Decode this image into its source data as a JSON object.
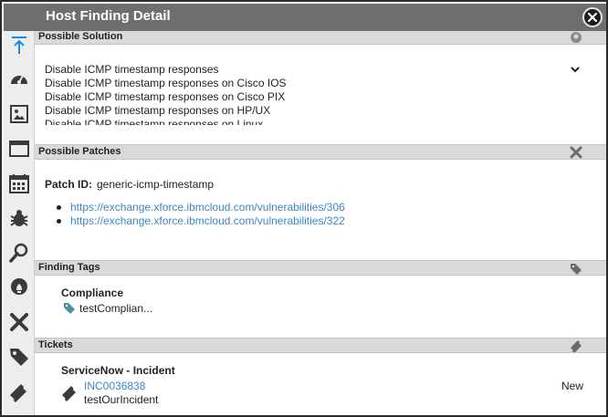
{
  "window": {
    "title": "Host Finding Detail"
  },
  "sidebar": {
    "icons": [
      "arrow-up-icon",
      "gauge-icon",
      "image-icon",
      "window-icon",
      "calendar-icon",
      "bug-icon",
      "wrench-icon",
      "lightbulb-icon",
      "tools-icon",
      "tag-icon",
      "ticket-icon"
    ]
  },
  "solution": {
    "header": "Possible Solution",
    "lines": [
      "Disable ICMP timestamp responses",
      "Disable ICMP timestamp responses on Cisco IOS",
      "Disable ICMP timestamp responses on Cisco PIX",
      "Disable ICMP timestamp responses on HP/UX",
      "Disable ICMP timestamp responses on Linux"
    ]
  },
  "patches": {
    "header": "Possible Patches",
    "patch_id_label": "Patch ID:",
    "patch_id": "generic-icmp-timestamp",
    "links": [
      "https://exchange.xforce.ibmcloud.com/vulnerabilities/306",
      "https://exchange.xforce.ibmcloud.com/vulnerabilities/322"
    ]
  },
  "tags": {
    "header": "Finding Tags",
    "category": "Compliance",
    "tag": "testComplian..."
  },
  "tickets": {
    "header": "Tickets",
    "system": "ServiceNow - Incident",
    "number": "INC0036838",
    "description": "testOurIncident",
    "status": "New"
  },
  "colors": {
    "title_bar": "#6e6e6e",
    "section_header": "#d9d9d9",
    "link": "#3c86c6",
    "accent_icon": "#1e88e5",
    "tag_icon": "#4a90a4"
  }
}
